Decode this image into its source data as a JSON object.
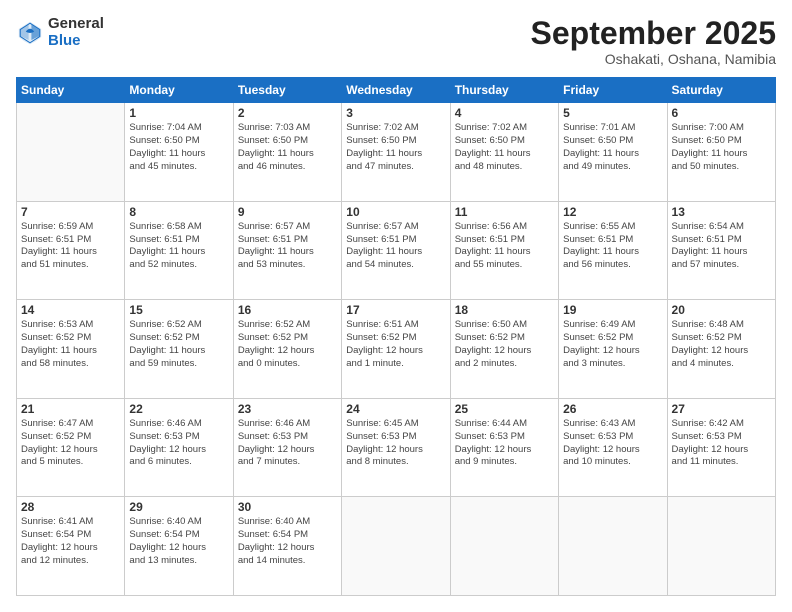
{
  "header": {
    "logo_general": "General",
    "logo_blue": "Blue",
    "month_title": "September 2025",
    "location": "Oshakati, Oshana, Namibia"
  },
  "days_of_week": [
    "Sunday",
    "Monday",
    "Tuesday",
    "Wednesday",
    "Thursday",
    "Friday",
    "Saturday"
  ],
  "weeks": [
    [
      {
        "day": "",
        "info": ""
      },
      {
        "day": "1",
        "info": "Sunrise: 7:04 AM\nSunset: 6:50 PM\nDaylight: 11 hours\nand 45 minutes."
      },
      {
        "day": "2",
        "info": "Sunrise: 7:03 AM\nSunset: 6:50 PM\nDaylight: 11 hours\nand 46 minutes."
      },
      {
        "day": "3",
        "info": "Sunrise: 7:02 AM\nSunset: 6:50 PM\nDaylight: 11 hours\nand 47 minutes."
      },
      {
        "day": "4",
        "info": "Sunrise: 7:02 AM\nSunset: 6:50 PM\nDaylight: 11 hours\nand 48 minutes."
      },
      {
        "day": "5",
        "info": "Sunrise: 7:01 AM\nSunset: 6:50 PM\nDaylight: 11 hours\nand 49 minutes."
      },
      {
        "day": "6",
        "info": "Sunrise: 7:00 AM\nSunset: 6:50 PM\nDaylight: 11 hours\nand 50 minutes."
      }
    ],
    [
      {
        "day": "7",
        "info": "Sunrise: 6:59 AM\nSunset: 6:51 PM\nDaylight: 11 hours\nand 51 minutes."
      },
      {
        "day": "8",
        "info": "Sunrise: 6:58 AM\nSunset: 6:51 PM\nDaylight: 11 hours\nand 52 minutes."
      },
      {
        "day": "9",
        "info": "Sunrise: 6:57 AM\nSunset: 6:51 PM\nDaylight: 11 hours\nand 53 minutes."
      },
      {
        "day": "10",
        "info": "Sunrise: 6:57 AM\nSunset: 6:51 PM\nDaylight: 11 hours\nand 54 minutes."
      },
      {
        "day": "11",
        "info": "Sunrise: 6:56 AM\nSunset: 6:51 PM\nDaylight: 11 hours\nand 55 minutes."
      },
      {
        "day": "12",
        "info": "Sunrise: 6:55 AM\nSunset: 6:51 PM\nDaylight: 11 hours\nand 56 minutes."
      },
      {
        "day": "13",
        "info": "Sunrise: 6:54 AM\nSunset: 6:51 PM\nDaylight: 11 hours\nand 57 minutes."
      }
    ],
    [
      {
        "day": "14",
        "info": "Sunrise: 6:53 AM\nSunset: 6:52 PM\nDaylight: 11 hours\nand 58 minutes."
      },
      {
        "day": "15",
        "info": "Sunrise: 6:52 AM\nSunset: 6:52 PM\nDaylight: 11 hours\nand 59 minutes."
      },
      {
        "day": "16",
        "info": "Sunrise: 6:52 AM\nSunset: 6:52 PM\nDaylight: 12 hours\nand 0 minutes."
      },
      {
        "day": "17",
        "info": "Sunrise: 6:51 AM\nSunset: 6:52 PM\nDaylight: 12 hours\nand 1 minute."
      },
      {
        "day": "18",
        "info": "Sunrise: 6:50 AM\nSunset: 6:52 PM\nDaylight: 12 hours\nand 2 minutes."
      },
      {
        "day": "19",
        "info": "Sunrise: 6:49 AM\nSunset: 6:52 PM\nDaylight: 12 hours\nand 3 minutes."
      },
      {
        "day": "20",
        "info": "Sunrise: 6:48 AM\nSunset: 6:52 PM\nDaylight: 12 hours\nand 4 minutes."
      }
    ],
    [
      {
        "day": "21",
        "info": "Sunrise: 6:47 AM\nSunset: 6:52 PM\nDaylight: 12 hours\nand 5 minutes."
      },
      {
        "day": "22",
        "info": "Sunrise: 6:46 AM\nSunset: 6:53 PM\nDaylight: 12 hours\nand 6 minutes."
      },
      {
        "day": "23",
        "info": "Sunrise: 6:46 AM\nSunset: 6:53 PM\nDaylight: 12 hours\nand 7 minutes."
      },
      {
        "day": "24",
        "info": "Sunrise: 6:45 AM\nSunset: 6:53 PM\nDaylight: 12 hours\nand 8 minutes."
      },
      {
        "day": "25",
        "info": "Sunrise: 6:44 AM\nSunset: 6:53 PM\nDaylight: 12 hours\nand 9 minutes."
      },
      {
        "day": "26",
        "info": "Sunrise: 6:43 AM\nSunset: 6:53 PM\nDaylight: 12 hours\nand 10 minutes."
      },
      {
        "day": "27",
        "info": "Sunrise: 6:42 AM\nSunset: 6:53 PM\nDaylight: 12 hours\nand 11 minutes."
      }
    ],
    [
      {
        "day": "28",
        "info": "Sunrise: 6:41 AM\nSunset: 6:54 PM\nDaylight: 12 hours\nand 12 minutes."
      },
      {
        "day": "29",
        "info": "Sunrise: 6:40 AM\nSunset: 6:54 PM\nDaylight: 12 hours\nand 13 minutes."
      },
      {
        "day": "30",
        "info": "Sunrise: 6:40 AM\nSunset: 6:54 PM\nDaylight: 12 hours\nand 14 minutes."
      },
      {
        "day": "",
        "info": ""
      },
      {
        "day": "",
        "info": ""
      },
      {
        "day": "",
        "info": ""
      },
      {
        "day": "",
        "info": ""
      }
    ]
  ]
}
